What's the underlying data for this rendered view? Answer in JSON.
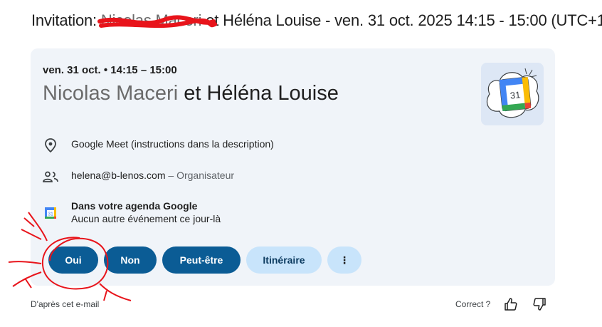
{
  "email": {
    "subject_prefix": "Invitation: ",
    "subject_redacted_name": "Nicolas Maceri ",
    "subject_suffix": "et Héléna Louise - ven. 31 oct. 2025 14:15 - 15:00 (UTC+1"
  },
  "event": {
    "date_line": "ven. 31 oct. • 14:15 – 15:00",
    "title_redacted_name": "Nicolas Maceri ",
    "title_suffix": "et Héléna Louise",
    "calendar_day": "31",
    "location": "Google Meet (instructions dans la description)",
    "organizer_email": "helena@b-lenos.com",
    "organizer_role": " – Organisateur",
    "calendar_heading": "Dans votre agenda Google",
    "calendar_status": "Aucun autre événement ce jour-là"
  },
  "actions": {
    "yes": "Oui",
    "no": "Non",
    "maybe": "Peut-être",
    "directions": "Itinéraire",
    "more": "⋮"
  },
  "footer": {
    "source": "D'après cet e-mail",
    "feedback_question": "Correct ?"
  },
  "colors": {
    "primary_button": "#0b5c95",
    "secondary_button": "#c8e4fb",
    "card_background": "#f0f4f9",
    "annotation_red": "#e8141b"
  }
}
